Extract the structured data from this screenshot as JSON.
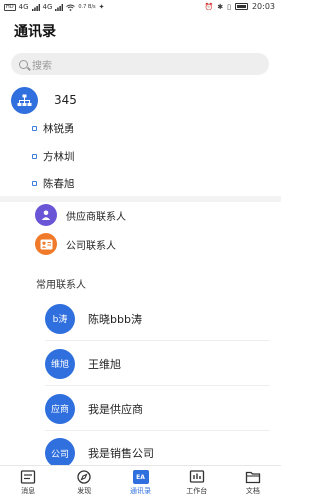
{
  "status_bar": {
    "left_labels": [
      "HD",
      "4G",
      "4G",
      "0.7 B/s"
    ],
    "time": "20:03"
  },
  "page_title": "通讯录",
  "search": {
    "placeholder": "搜索"
  },
  "org": {
    "name": "345",
    "members": [
      "林锐勇",
      "方林圳",
      "陈春旭"
    ]
  },
  "groups": [
    {
      "label": "供应商联系人",
      "color": "#6a55d6"
    },
    {
      "label": "公司联系人",
      "color": "#f07a2a"
    }
  ],
  "frequent": {
    "title": "常用联系人",
    "contacts": [
      {
        "avatar": "b涛",
        "name": "陈晓bbb涛"
      },
      {
        "avatar": "维旭",
        "name": "王维旭"
      },
      {
        "avatar": "应商",
        "name": "我是供应商"
      },
      {
        "avatar": "公司",
        "name": "我是销售公司"
      }
    ]
  },
  "tabs": [
    {
      "label": "消息",
      "icon": "message-icon",
      "active": false
    },
    {
      "label": "发现",
      "icon": "compass-icon",
      "active": false
    },
    {
      "label": "通讯录",
      "icon": "contacts-icon",
      "active": true
    },
    {
      "label": "工作台",
      "icon": "workbench-icon",
      "active": false
    },
    {
      "label": "文档",
      "icon": "folder-icon",
      "active": false
    }
  ],
  "colors": {
    "accent": "#2f6fde"
  }
}
